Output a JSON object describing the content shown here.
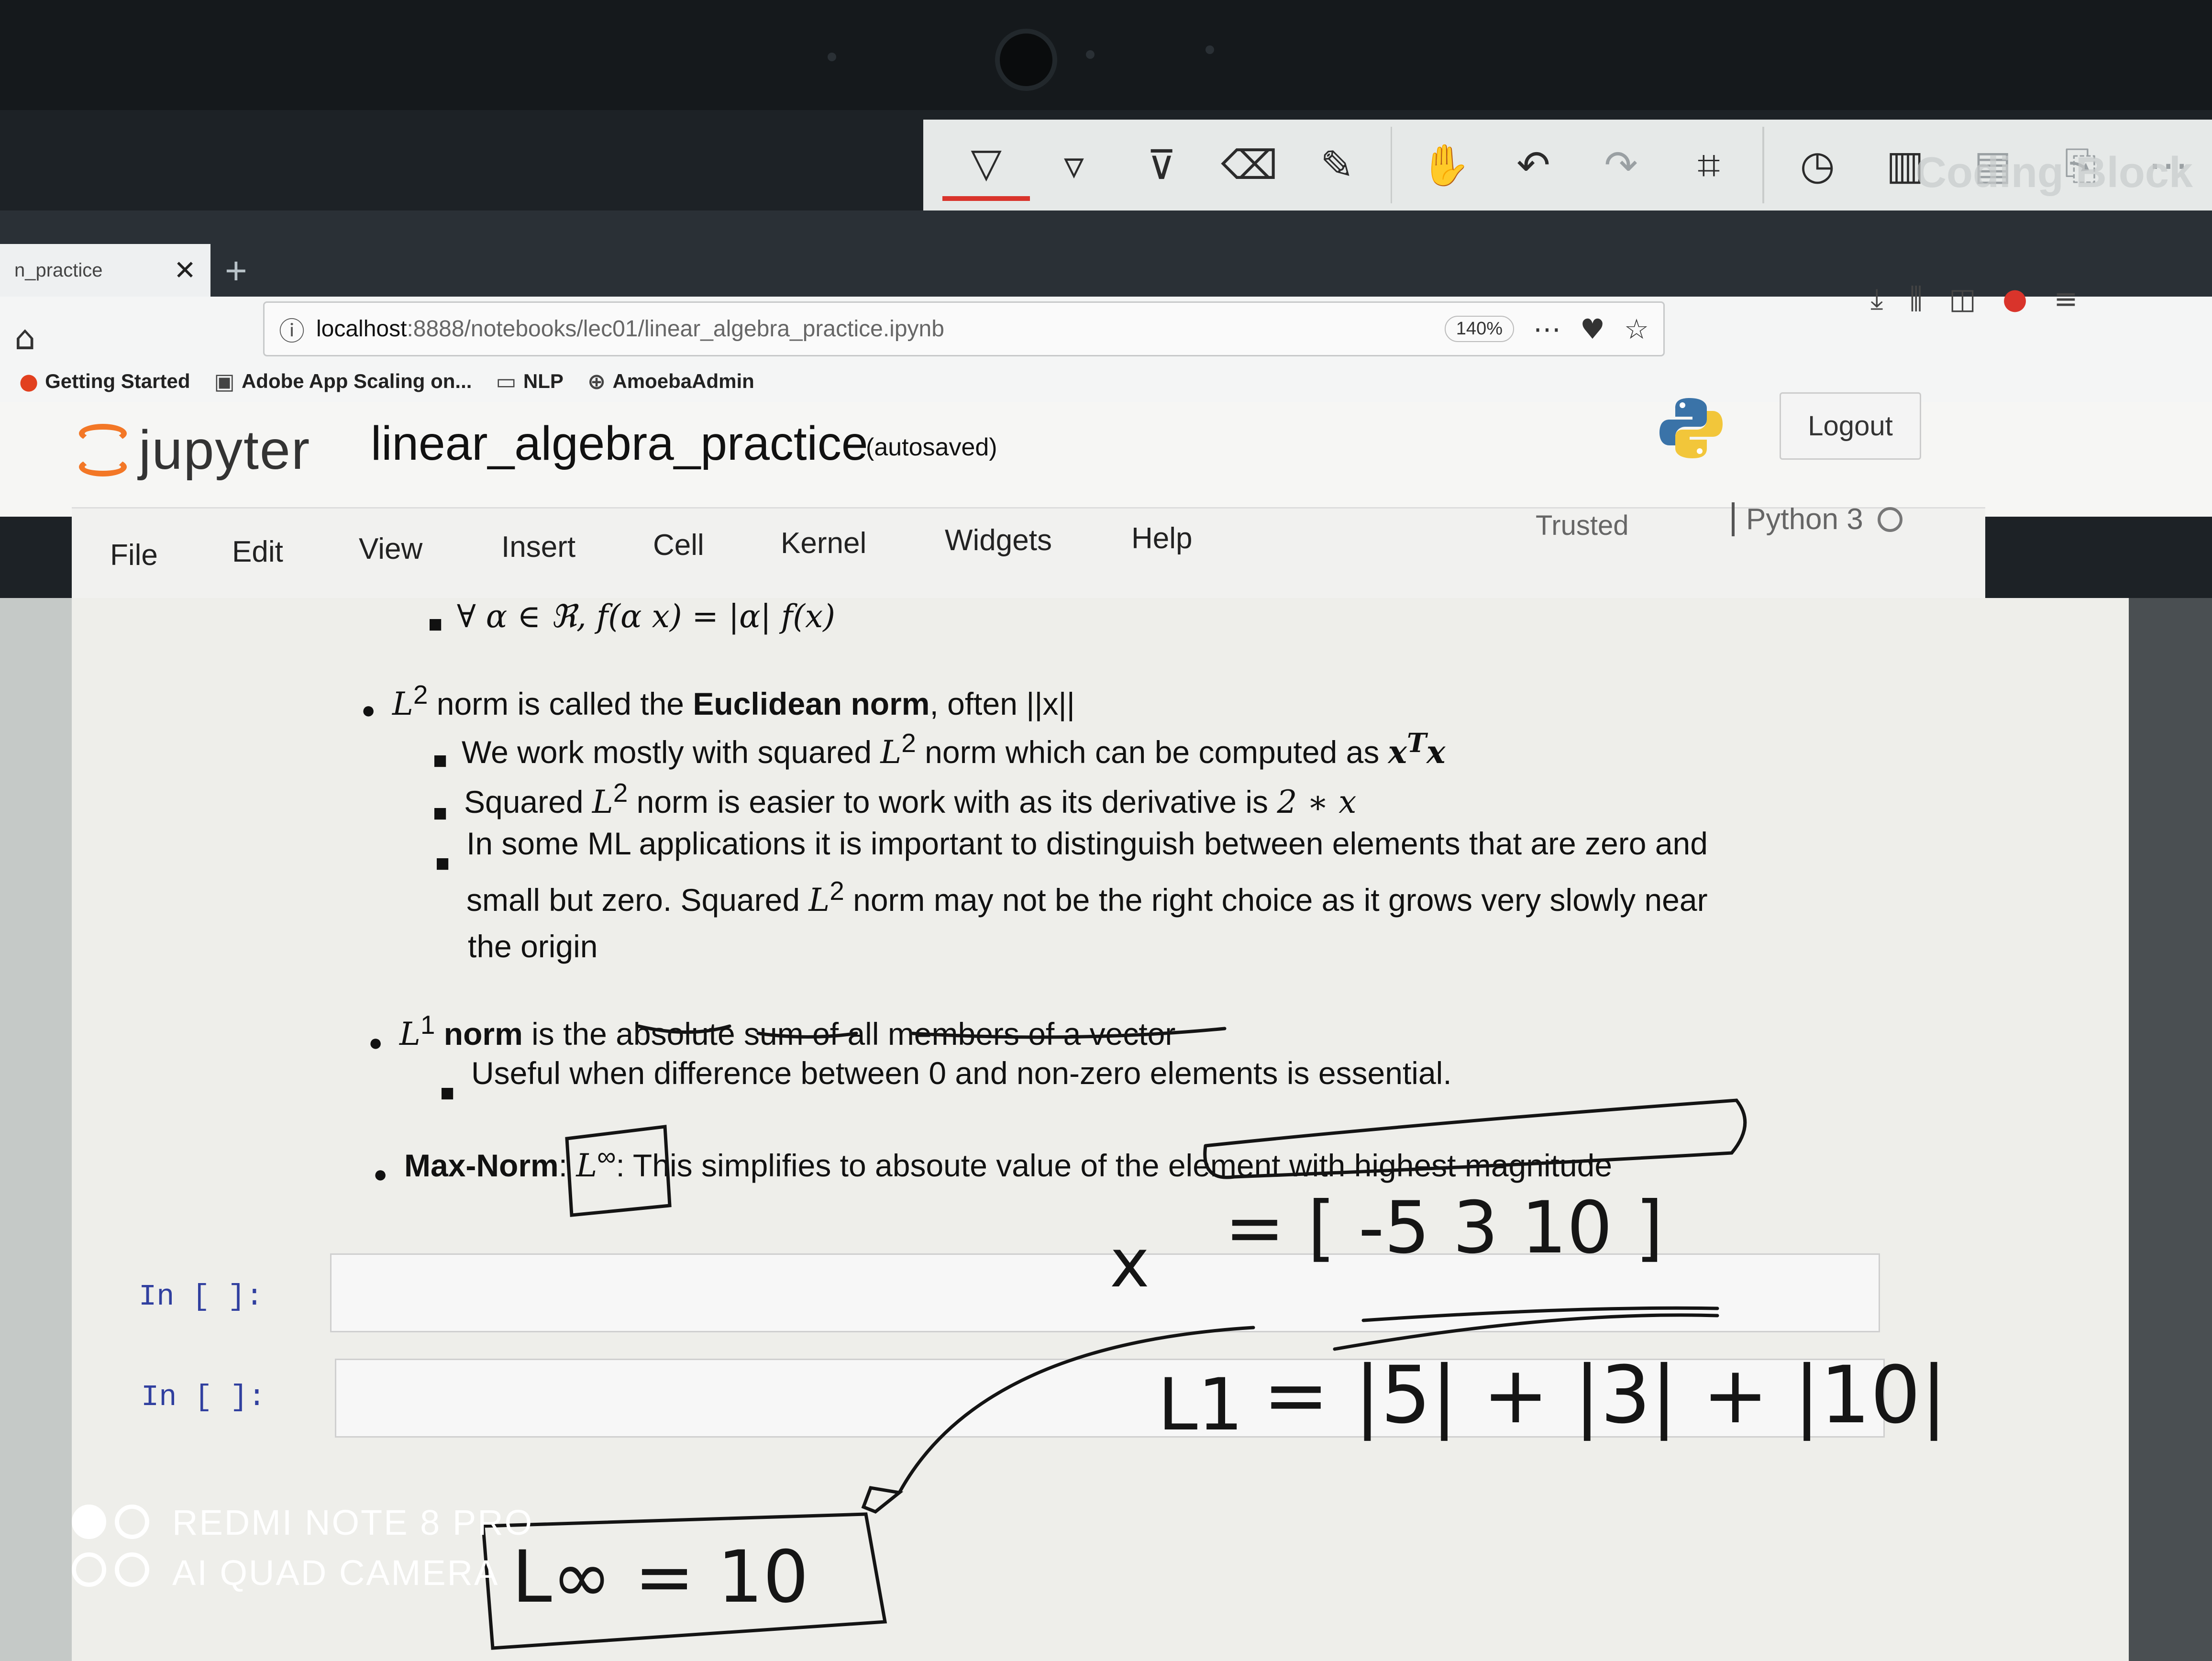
{
  "annotation_toolbar": {
    "tools": [
      "pen-icon",
      "marker-icon",
      "highlighter-icon",
      "eraser-icon",
      "ruler-icon",
      "hand-icon",
      "undo-icon",
      "redo-icon",
      "crop-icon",
      "history-icon",
      "delete-icon",
      "save-icon",
      "share-icon",
      "more-icon"
    ],
    "watermark": "Coding Block"
  },
  "browser": {
    "tab_title": "n_practice",
    "url_host": "localhost",
    "url_path": ":8888/notebooks/lec01/linear_algebra_practice.ipynb",
    "zoom": "140%",
    "bookmarks": [
      "Getting Started",
      "Adobe App Scaling on...",
      "NLP",
      "AmoebaAdmin"
    ]
  },
  "jupyter": {
    "logo_text": "jupyter",
    "notebook_name": "linear_algebra_practice",
    "save_status": "(autosaved)",
    "logout_label": "Logout",
    "menu": [
      "File",
      "Edit",
      "View",
      "Insert",
      "Cell",
      "Kernel",
      "Widgets",
      "Help"
    ],
    "trusted_label": "Trusted",
    "kernel_name": "Python 3"
  },
  "content": {
    "line_homog": "∀ α ∈ ℜ, f(α x) = |α| f(x)",
    "l2_a": " norm is called the ",
    "l2_b": "Euclidean norm",
    "l2_c": ", often ||x||",
    "l2_sub1_a": "We work mostly with squared ",
    "l2_sub1_b": " norm which can be computed as ",
    "l2_sub2_a": "Squared ",
    "l2_sub2_b": " norm is easier to work with as its derivative is ",
    "l2_sub2_c": "2 ∗ x",
    "l2_sub3_l1": "In some ML applications it is important to distinguish between elements that are zero and",
    "l2_sub3_l2a": "small but zero. Squared ",
    "l2_sub3_l2b": " norm may not be the right choice as it grows very slowly near",
    "l2_sub3_l3": "the origin",
    "l1_a": " norm",
    "l1_b": " is the absolute sum of all members of a vector",
    "l1_sub1": "Useful when difference between 0 and non-zero elements is essential.",
    "max_a": "Max-Norm",
    "max_b": ": ",
    "max_c": ": This simplifies to absoute value of the element with highest magnitude",
    "L": "L",
    "sup2": "2",
    "sup1": "1",
    "supinf": "∞",
    "xTx": "xTx"
  },
  "cells": [
    {
      "prompt": "In [ ]:"
    },
    {
      "prompt": "In [ ]:"
    }
  ],
  "handwriting": {
    "x_label": "x",
    "vector": "= [ -5   3   10 ]",
    "l1_label": "L1",
    "l1_eq": "= |5| + |3| + |10|",
    "linf": "L∞  = 10"
  },
  "phone_watermark": {
    "line1": "REDMI NOTE 8 PRO",
    "line2": "AI QUAD CAMERA"
  }
}
